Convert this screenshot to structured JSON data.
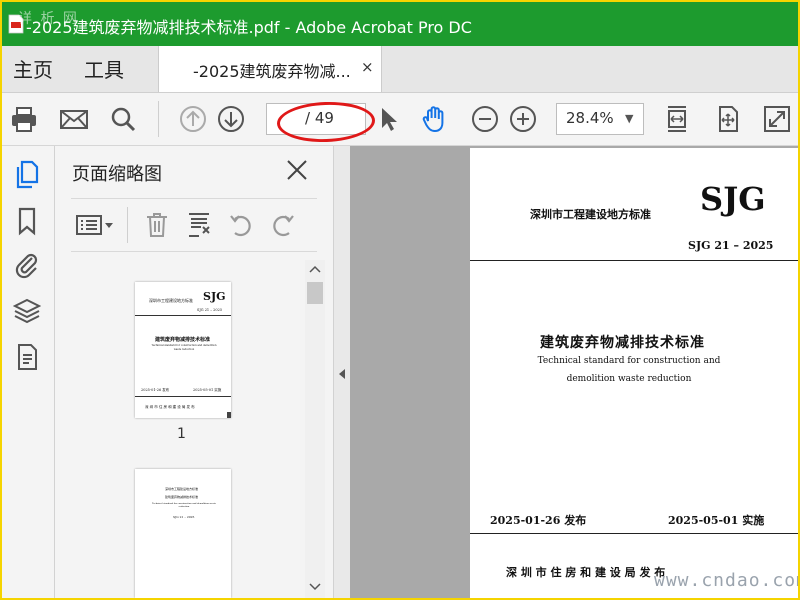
{
  "window": {
    "title": "-2025建筑废弃物减排技术标准.pdf - Adobe Acrobat Pro DC",
    "watermark": "详 析 网"
  },
  "menu": {
    "home": "主页",
    "tools": "工具"
  },
  "tab": {
    "label": "-2025建筑废弃物减...",
    "close": "×"
  },
  "toolbar": {
    "page_current": "",
    "page_total": "/ 49",
    "zoom": "28.4%",
    "zoom_arrow": "▼"
  },
  "panel": {
    "title": "页面缩略图",
    "thumb_label": "1"
  },
  "thumb1": {
    "org": "深圳市工程建设地方标准",
    "code": "SJG",
    "number": "SJG 21 – 2025",
    "title": "建筑废弃物减排技术标准",
    "en": "Technical standard for construction and demolition waste reduction",
    "issue": "2025-01-26 发布",
    "effective": "2025-05-01 实施",
    "publisher": "深 圳 市 住 房 和 建 设 局 发 布"
  },
  "thumb2": {
    "org": "深圳市工程建设地方标准",
    "title": "建筑废弃物减排技术标准",
    "en": "Technical standard for construction and demolition waste reduction",
    "number": "SJG 21 – 2025"
  },
  "page": {
    "org": "深圳市工程建设地方标准",
    "code": "SJG",
    "number": "SJG 21 – 2025",
    "title": "建筑废弃物减排技术标准",
    "en_line1": "Technical standard for construction and",
    "en_line2": "demolition waste reduction",
    "issue": "2025-01-26  发布",
    "effective": "2025-05-01  实施",
    "publisher": "深 圳 市 住 房 和 建 设 局   发 布"
  },
  "site_watermark": "www.cndao.com",
  "colors": {
    "titlebar": "#1d9b2e",
    "accent": "#1473e6",
    "highlight": "#e01818"
  }
}
